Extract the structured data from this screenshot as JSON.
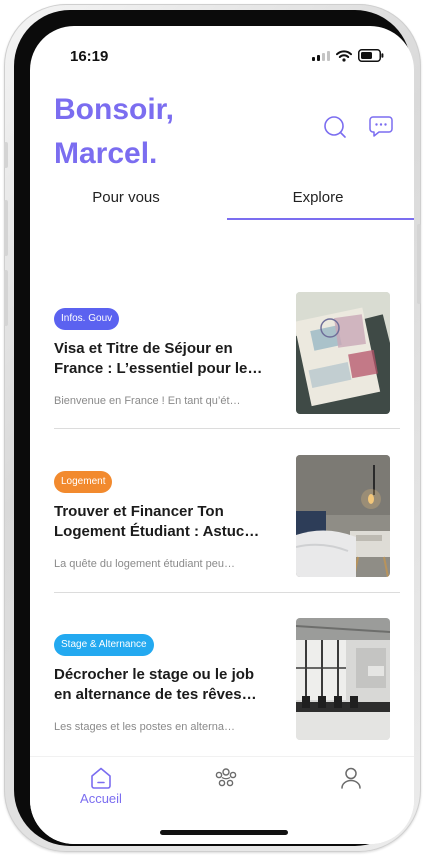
{
  "status_bar": {
    "time": "16:19"
  },
  "header": {
    "greeting_line1": "Bonsoir,",
    "greeting_line2": "Marcel."
  },
  "icons": {
    "search": "search-icon",
    "messages": "chat-bubble-icon",
    "home": "home-icon",
    "community": "community-icon",
    "profile": "person-icon"
  },
  "tabs": [
    {
      "label": "Pour vous",
      "active": false
    },
    {
      "label": "Explore",
      "active": true
    }
  ],
  "articles": [
    {
      "category": "Infos. Gouv",
      "category_color": "#5b62f0",
      "title_line1": "Visa et Titre de Séjour en",
      "title_line2": "France : L’essentiel pour le…",
      "excerpt": "Bienvenue en France ! En tant qu’ét…",
      "image": "passport-photo"
    },
    {
      "category": "Logement",
      "category_color": "#f28a2e",
      "title_line1": "Trouver et Financer Ton",
      "title_line2": "Logement Étudiant : Astuc…",
      "excerpt": "La quête du logement étudiant peu…",
      "image": "bedroom-photo"
    },
    {
      "category": "Stage & Alternance",
      "category_color": "#23a9f0",
      "title_line1": "Décrocher le stage ou le job",
      "title_line2": "en alternance de tes rêves…",
      "excerpt": "Les stages et les postes en alterna…",
      "image": "office-photo"
    }
  ],
  "bottom_nav": [
    {
      "label": "Accueil",
      "active": true
    },
    {
      "label": "",
      "active": false
    },
    {
      "label": "",
      "active": false
    }
  ],
  "colors": {
    "accent": "#7b6df0"
  }
}
